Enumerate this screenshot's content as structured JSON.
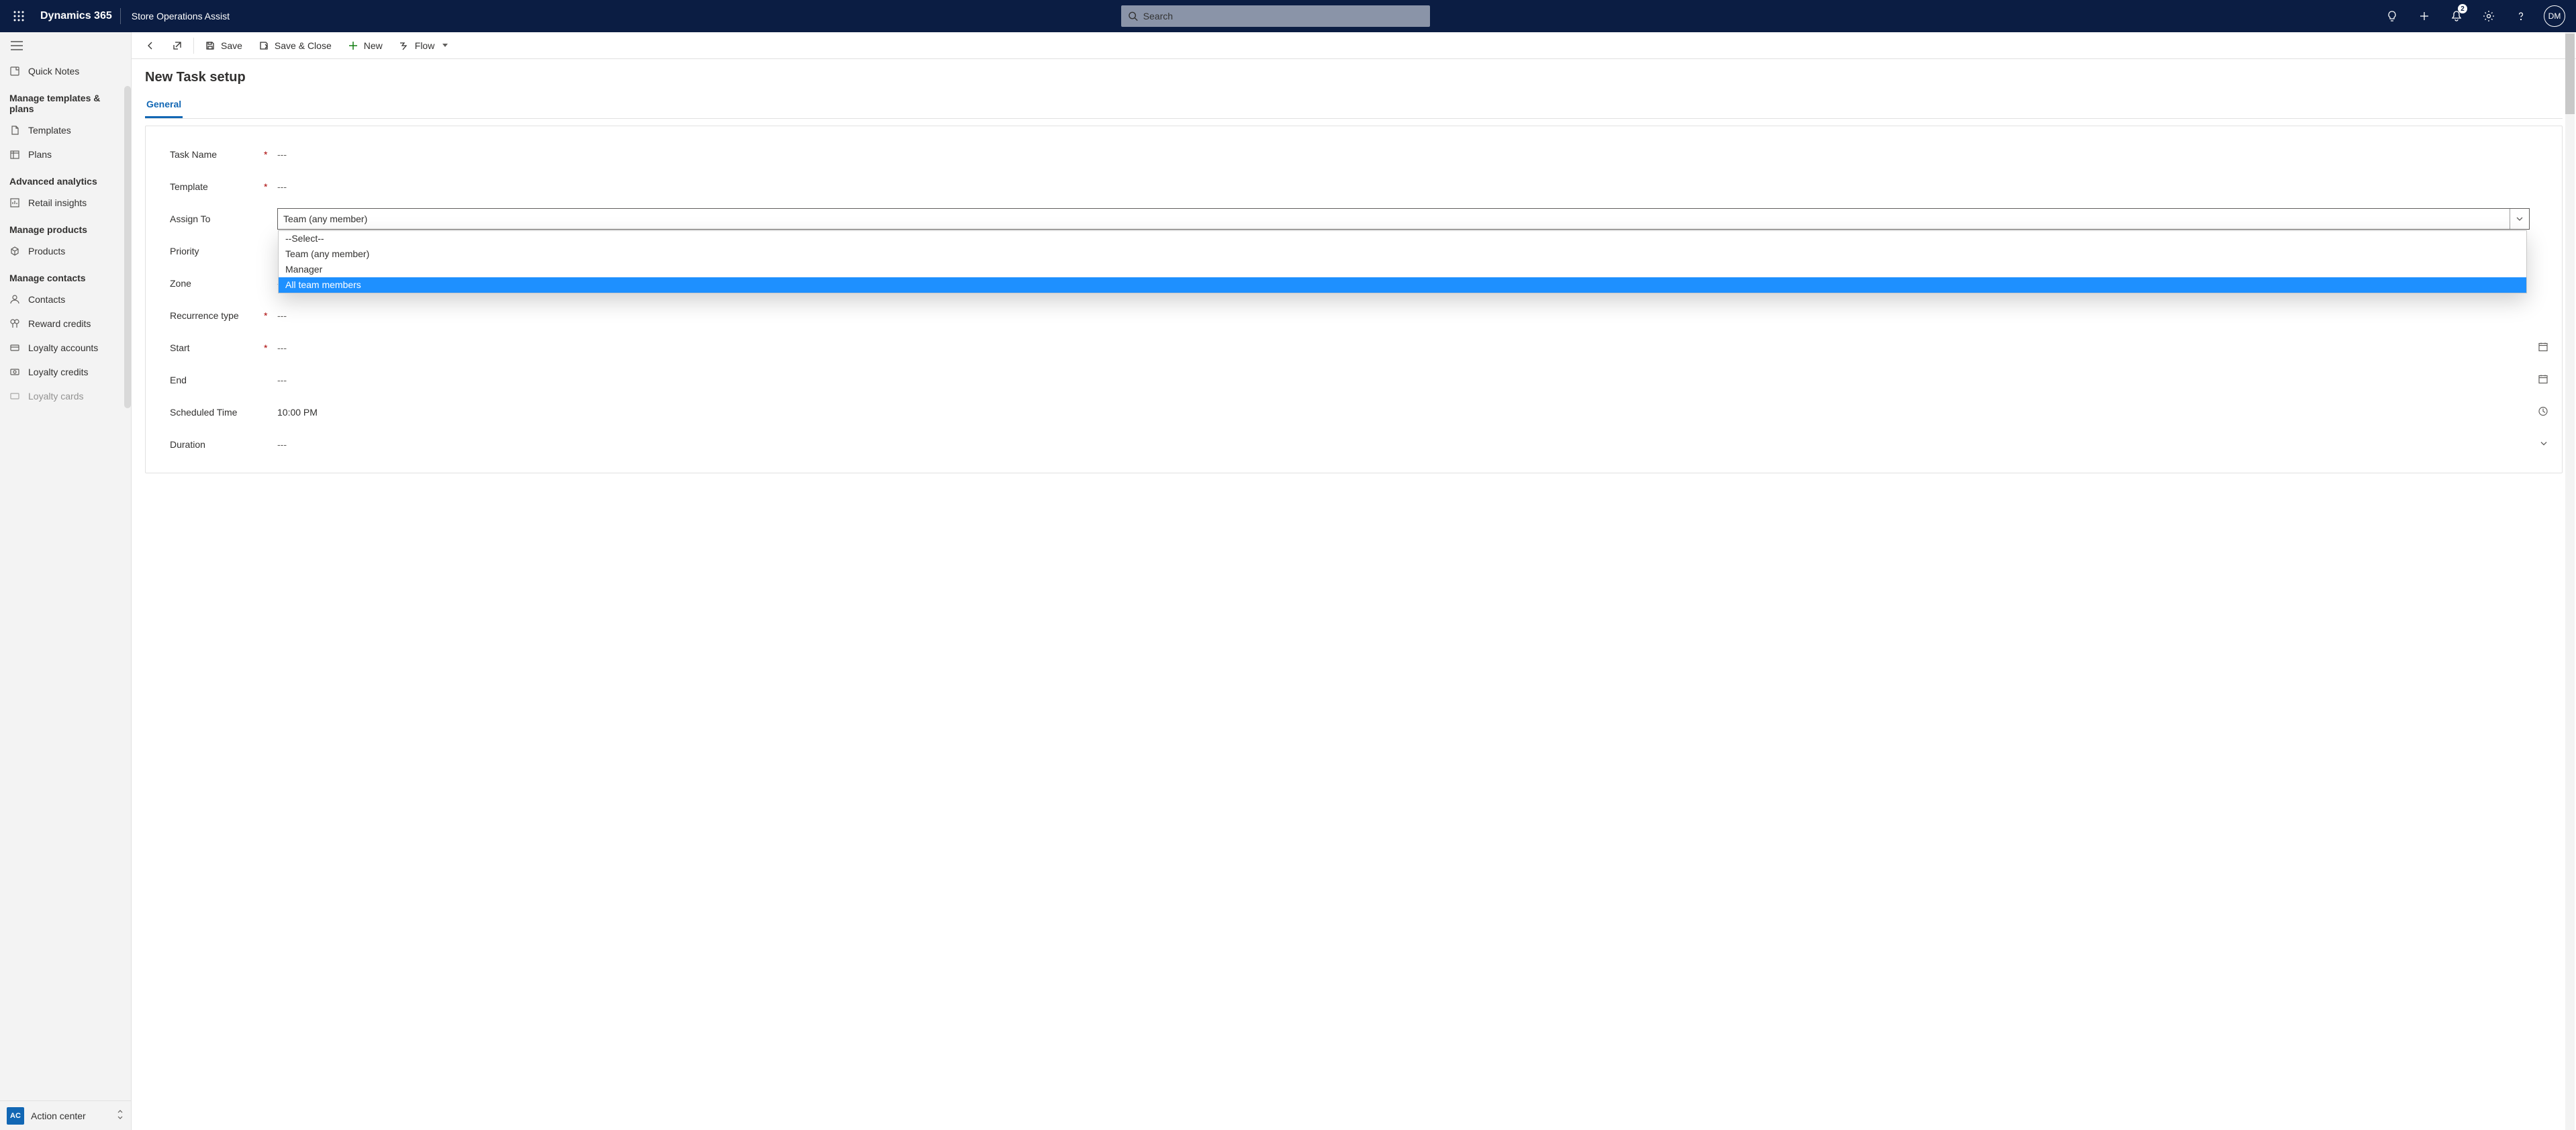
{
  "header": {
    "brand": "Dynamics 365",
    "app": "Store Operations Assist",
    "search_placeholder": "Search",
    "notification_count": "2",
    "avatar_initials": "DM"
  },
  "sidebar": {
    "quick_notes": "Quick Notes",
    "section_templates": "Manage templates & plans",
    "templates": "Templates",
    "plans": "Plans",
    "section_analytics": "Advanced analytics",
    "retail_insights": "Retail insights",
    "section_products": "Manage products",
    "products": "Products",
    "section_contacts": "Manage contacts",
    "contacts": "Contacts",
    "reward_credits": "Reward credits",
    "loyalty_accounts": "Loyalty accounts",
    "loyalty_credits": "Loyalty credits",
    "loyalty_cards": "Loyalty cards",
    "footer_badge": "AC",
    "footer_label": "Action center"
  },
  "commands": {
    "save": "Save",
    "save_close": "Save & Close",
    "new": "New",
    "flow": "Flow"
  },
  "page": {
    "title": "New Task setup",
    "tab_general": "General"
  },
  "form": {
    "task_name_label": "Task Name",
    "task_name_value": "---",
    "template_label": "Template",
    "template_value": "---",
    "assign_to_label": "Assign To",
    "assign_to_value": "Team (any member)",
    "priority_label": "Priority",
    "zone_label": "Zone",
    "zone_value": "---",
    "recurrence_label": "Recurrence type",
    "recurrence_value": "---",
    "start_label": "Start",
    "start_value": "---",
    "end_label": "End",
    "end_value": "---",
    "scheduled_label": "Scheduled Time",
    "scheduled_value": "10:00 PM",
    "duration_label": "Duration",
    "duration_value": "---"
  },
  "dropdown": {
    "opt0": "--Select--",
    "opt1": "Team (any member)",
    "opt2": "Manager",
    "opt3": "All team members"
  }
}
